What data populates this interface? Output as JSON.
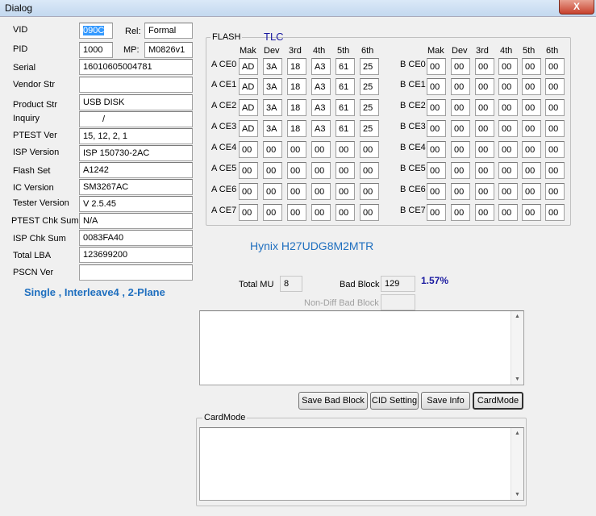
{
  "window": {
    "title": "Dialog",
    "close": "X"
  },
  "left": {
    "vid_label": "VID",
    "vid_value": "090C",
    "rel_label": "Rel:",
    "rel_value": "Formal",
    "pid_label": "PID",
    "pid_value": "1000",
    "mp_label": "MP:",
    "mp_value": "M0826v1",
    "serial_label": "Serial",
    "serial_value": "16010605004781",
    "vendor_label": "Vendor Str",
    "vendor_value": "",
    "product_label": "Product Str",
    "product_value": "USB DISK",
    "inquiry_label": "Inquiry",
    "inquiry_value": "/",
    "ptest_ver_label": "PTEST Ver",
    "ptest_ver_value": "15, 12, 2, 1",
    "isp_ver_label": "ISP Version",
    "isp_ver_value": "ISP 150730-2AC",
    "flash_set_label": "Flash Set",
    "flash_set_value": "A1242",
    "ic_ver_label": "IC Version",
    "ic_ver_value": "SM3267AC",
    "tester_ver_label": "Tester Version",
    "tester_ver_value": "V 2.5.45",
    "ptest_chk_label": "PTEST Chk Sum",
    "ptest_chk_value": "N/A",
    "isp_chk_label": "ISP Chk Sum",
    "isp_chk_value": "0083FA40",
    "total_lba_label": "Total LBA",
    "total_lba_value": "123699200",
    "pscn_label": "PSCN Ver",
    "pscn_value": "",
    "mode_text": "Single , Interleave4 , 2-Plane"
  },
  "flash": {
    "group_label": "FLASH",
    "type": "TLC",
    "columns": [
      "Mak",
      "Dev",
      "3rd",
      "4th",
      "5th",
      "6th"
    ],
    "a_rows": [
      {
        "label": "A CE0",
        "cells": [
          "AD",
          "3A",
          "18",
          "A3",
          "61",
          "25"
        ]
      },
      {
        "label": "A CE1",
        "cells": [
          "AD",
          "3A",
          "18",
          "A3",
          "61",
          "25"
        ]
      },
      {
        "label": "A CE2",
        "cells": [
          "AD",
          "3A",
          "18",
          "A3",
          "61",
          "25"
        ]
      },
      {
        "label": "A CE3",
        "cells": [
          "AD",
          "3A",
          "18",
          "A3",
          "61",
          "25"
        ]
      },
      {
        "label": "A CE4",
        "cells": [
          "00",
          "00",
          "00",
          "00",
          "00",
          "00"
        ]
      },
      {
        "label": "A CE5",
        "cells": [
          "00",
          "00",
          "00",
          "00",
          "00",
          "00"
        ]
      },
      {
        "label": "A CE6",
        "cells": [
          "00",
          "00",
          "00",
          "00",
          "00",
          "00"
        ]
      },
      {
        "label": "A CE7",
        "cells": [
          "00",
          "00",
          "00",
          "00",
          "00",
          "00"
        ]
      }
    ],
    "b_rows": [
      {
        "label": "B CE0",
        "cells": [
          "00",
          "00",
          "00",
          "00",
          "00",
          "00"
        ]
      },
      {
        "label": "B CE1",
        "cells": [
          "00",
          "00",
          "00",
          "00",
          "00",
          "00"
        ]
      },
      {
        "label": "B CE2",
        "cells": [
          "00",
          "00",
          "00",
          "00",
          "00",
          "00"
        ]
      },
      {
        "label": "B CE3",
        "cells": [
          "00",
          "00",
          "00",
          "00",
          "00",
          "00"
        ]
      },
      {
        "label": "B CE4",
        "cells": [
          "00",
          "00",
          "00",
          "00",
          "00",
          "00"
        ]
      },
      {
        "label": "B CE5",
        "cells": [
          "00",
          "00",
          "00",
          "00",
          "00",
          "00"
        ]
      },
      {
        "label": "B CE6",
        "cells": [
          "00",
          "00",
          "00",
          "00",
          "00",
          "00"
        ]
      },
      {
        "label": "B CE7",
        "cells": [
          "00",
          "00",
          "00",
          "00",
          "00",
          "00"
        ]
      }
    ],
    "part_number": "Hynix H27UDG8M2MTR"
  },
  "stats": {
    "total_mu_label": "Total MU",
    "total_mu_value": "8",
    "bad_block_label": "Bad Block",
    "bad_block_value": "129",
    "bad_block_pct": "1.57%",
    "non_diff_label": "Non-Diff Bad Block",
    "non_diff_value": ""
  },
  "buttons": {
    "save_bad_block": "Save Bad Block",
    "cid_setting": "CID Setting",
    "save_info": "Save Info",
    "card_mode": "CardMode"
  },
  "cardmode": {
    "group_label": "CardMode"
  }
}
